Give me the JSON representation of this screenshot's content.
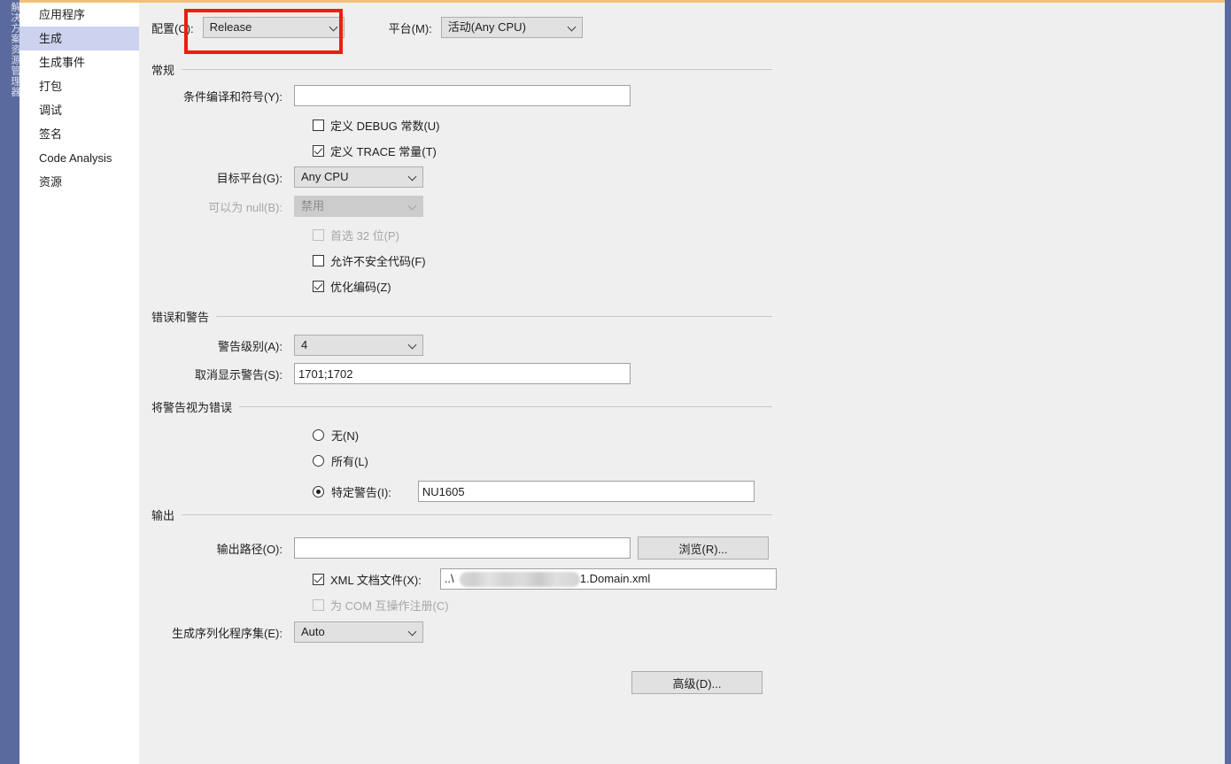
{
  "window": {
    "accent_color": "#f0c07a",
    "rail_color": "#5b6a9e",
    "panel_bg": "#efefef",
    "selected_nav_bg": "#cdd2ee",
    "highlight_color": "#ee1c11",
    "rail_label": "解决方案资源管理器"
  },
  "sidebar": {
    "items": [
      {
        "label": "应用程序",
        "selected": false
      },
      {
        "label": "生成",
        "selected": true
      },
      {
        "label": "生成事件",
        "selected": false
      },
      {
        "label": "打包",
        "selected": false
      },
      {
        "label": "调试",
        "selected": false
      },
      {
        "label": "签名",
        "selected": false
      },
      {
        "label": "Code Analysis",
        "selected": false
      },
      {
        "label": "资源",
        "selected": false
      }
    ]
  },
  "toolbar": {
    "configuration_label": "配置(C):",
    "configuration_value": "Release",
    "platform_label": "平台(M):",
    "platform_value": "活动(Any CPU)"
  },
  "general": {
    "title": "常规",
    "conditional_symbols_label": "条件编译和符号(Y):",
    "conditional_symbols_value": "",
    "conditional_symbols_placeholder": "",
    "define_debug_label": "定义 DEBUG 常数(U)",
    "define_debug_checked": false,
    "define_trace_label": "定义 TRACE 常量(T)",
    "define_trace_checked": true,
    "target_platform_label": "目标平台(G):",
    "target_platform_value": "Any CPU",
    "nullable_label": "可以为 null(B):",
    "nullable_value": "禁用",
    "nullable_disabled": true,
    "prefer32_label": "首选 32 位(P)",
    "prefer32_checked": false,
    "prefer32_disabled": true,
    "unsafe_label": "允许不安全代码(F)",
    "unsafe_checked": false,
    "optimize_label": "优化编码(Z)",
    "optimize_checked": true
  },
  "errors_warnings": {
    "title": "错误和警告",
    "warning_level_label": "警告级别(A):",
    "warning_level_value": "4",
    "suppress_warnings_label": "取消显示警告(S):",
    "suppress_warnings_value": "1701;1702"
  },
  "treat_warnings": {
    "title": "将警告视为错误",
    "none_label": "无(N)",
    "none_selected": false,
    "all_label": "所有(L)",
    "all_selected": false,
    "specific_label": "特定警告(I):",
    "specific_selected": true,
    "specific_value": "NU1605"
  },
  "output": {
    "title": "输出",
    "output_path_label": "输出路径(O):",
    "output_path_value": "",
    "browse_label": "浏览(R)...",
    "xml_doc_label": "XML 文档文件(X):",
    "xml_doc_checked": true,
    "xml_doc_prefix": "..\\",
    "xml_doc_suffix": "1.Domain.xml",
    "com_interop_label": "为 COM 互操作注册(C)",
    "com_interop_checked": false,
    "com_interop_disabled": true,
    "serialization_label": "生成序列化程序集(E):",
    "serialization_value": "Auto"
  },
  "footer": {
    "advanced_label": "高级(D)..."
  }
}
